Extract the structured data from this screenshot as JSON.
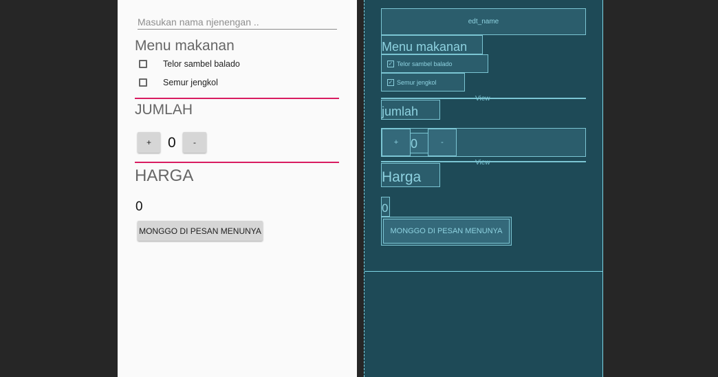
{
  "form": {
    "name_placeholder": "Masukan nama njenengan ..",
    "menu_heading": "Menu makanan",
    "options": [
      "Telor sambel balado",
      "Semur jengkol"
    ],
    "quantity_heading": "JUMLAH",
    "plus_label": "+",
    "quantity_value": "0",
    "minus_label": "-",
    "price_heading": "HARGA",
    "price_value": "0",
    "order_button": "MONGGO DI PESAN MENUNYA"
  },
  "blueprint": {
    "edt_name": "edt_name",
    "menu_heading": "Menu makanan",
    "options": [
      "Telor sambel balado",
      "Semur jengkol"
    ],
    "view_label": "View",
    "quantity_heading": "jumlah",
    "plus_label": "+",
    "quantity_value": "0",
    "minus_label": "-",
    "price_heading": "Harga",
    "price_value": "0",
    "order_button": "MONGGO DI PESAN MENUNYA",
    "check_glyph": "✓"
  }
}
